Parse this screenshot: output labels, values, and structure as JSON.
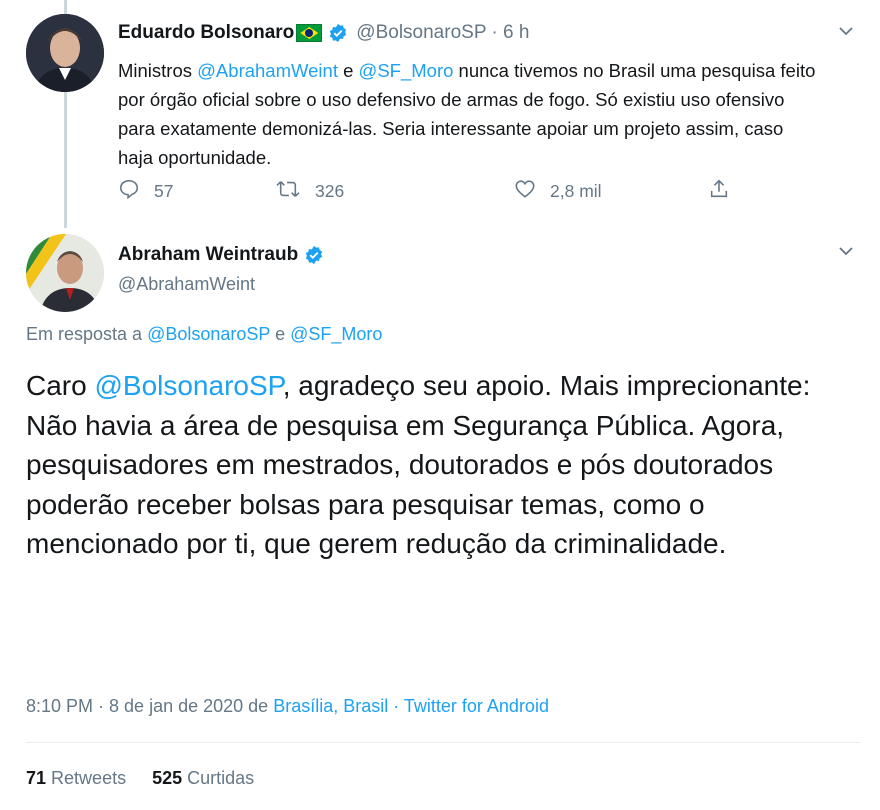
{
  "tweet1": {
    "name": "Eduardo Bolsonaro",
    "handle_time": "@BolsonaroSP · 6 h",
    "text_prefix": "Ministros ",
    "mention1": "@AbrahamWeint",
    "text_and": " e ",
    "mention2": "@SF_Moro",
    "text_body": " nunca tivemos no Brasil uma pesquisa feito por órgão oficial sobre o uso defensivo de armas de fogo. Só existiu uso ofensivo para exatamente demonizá-las. Seria interessante apoiar um projeto assim, caso haja oportunidade.",
    "replies": "57",
    "retweets": "326",
    "likes": "2,8 mil"
  },
  "tweet2": {
    "name": "Abraham Weintraub",
    "handle": "@AbrahamWeint",
    "reply_to_prefix": "Em resposta a ",
    "reply_to_mention1": "@BolsonaroSP",
    "reply_to_and": " e ",
    "reply_to_mention2": "@SF_Moro",
    "text_prefix": "Caro ",
    "text_mention": "@BolsonaroSP",
    "text_body": ", agradeço seu apoio. Mais imprecionante: Não havia a área de pesquisa em Segurança Pública. Agora, pesquisadores em mestrados, doutorados e pós doutorados poderão receber bolsas para pesquisar temas, como o mencionado por ti, que gerem redução da criminalidade.",
    "timestamp": "8:10 PM · 8 de jan de 2020 de ",
    "location": "Brasília, Brasil",
    "separator": " · ",
    "source": "Twitter for Android",
    "retweet_count": "71",
    "retweet_label": "Retweets",
    "like_count": "525",
    "like_label": "Curtidas"
  },
  "colors": {
    "accent": "#1da1f2",
    "muted": "#657786",
    "text": "#14171a"
  },
  "icons": [
    "verified-icon",
    "brazil-flag-icon",
    "chevron-down-icon",
    "reply-icon",
    "retweet-icon",
    "like-icon",
    "share-icon"
  ]
}
